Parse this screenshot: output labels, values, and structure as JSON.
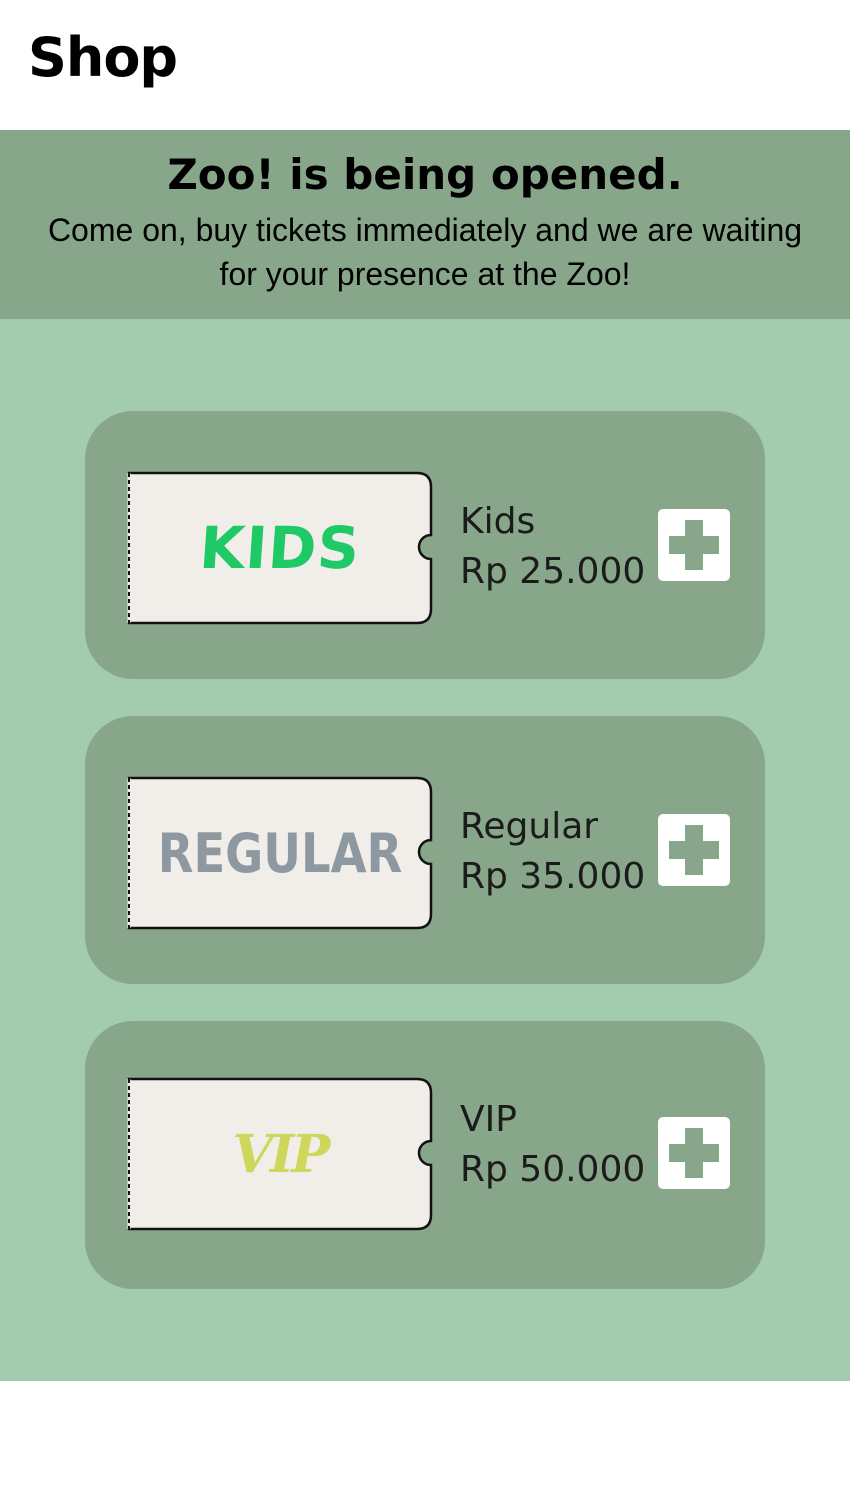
{
  "header": {
    "title": "Shop"
  },
  "banner": {
    "title": "Zoo! is being opened.",
    "subtitle": "Come on, buy tickets immediately and we are waiting for your presence at the Zoo!"
  },
  "tickets": [
    {
      "badge": "KIDS",
      "name": "Kids",
      "price": "Rp 25.000",
      "badge_color": "#1fc966",
      "add_icon": "plus-icon"
    },
    {
      "badge": "REGULAR",
      "name": "Regular",
      "price": "Rp 35.000",
      "badge_color": "#8e98a0",
      "add_icon": "plus-icon"
    },
    {
      "badge": "VIP",
      "name": "VIP",
      "price": "Rp 50.000",
      "badge_color": "#cfd65c",
      "add_icon": "plus-icon"
    }
  ],
  "colors": {
    "banner_bg": "#88a78a",
    "content_bg": "#a3cbaf",
    "card_bg": "#88a78a",
    "ticket_bg": "#f1eeea",
    "plus_color": "#88a78a"
  }
}
